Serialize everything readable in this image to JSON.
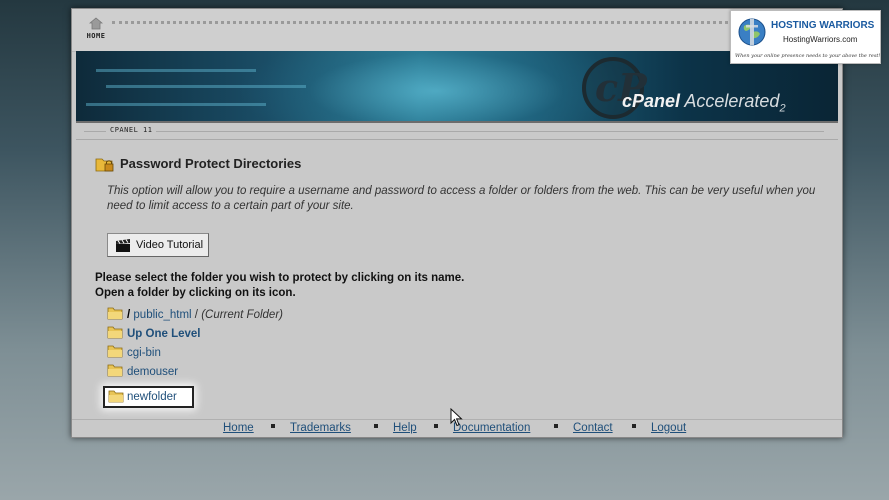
{
  "topnav": {
    "home_label": "HOME"
  },
  "banner": {
    "logo_letter": "cP",
    "brand_main": "cPanel",
    "brand_accent": "Accelerated",
    "brand_version": "2"
  },
  "version_label": "CPANEL 11",
  "page": {
    "title": "Password Protect Directories",
    "description": "This option will allow you to require a username and password to access a folder or folders from the web. This can be very useful when you need to limit access to a certain part of your site.",
    "video_button": "Video Tutorial",
    "instruction_line1": "Please select the folder you wish to protect by clicking on its name.",
    "instruction_line2": "Open a folder by clicking on its icon."
  },
  "breadcrumb": {
    "root": "/",
    "folder": "public_html",
    "separator": "/",
    "current": "(Current Folder)"
  },
  "folders": [
    "Up One Level",
    "cgi-bin",
    "demouser",
    "newfolder"
  ],
  "footer": [
    "Home",
    "Trademarks",
    "Help",
    "Documentation",
    "Contact",
    "Logout"
  ],
  "badge": {
    "name": "HOSTING WARRIORS",
    "url": "HostingWarriors.com",
    "tagline": "When your online presence needs to your above the rest!"
  },
  "colors": {
    "link": "#1f4f7a",
    "panel_bg": "#c9c9c9",
    "banner_accent": "#2b7b94"
  }
}
